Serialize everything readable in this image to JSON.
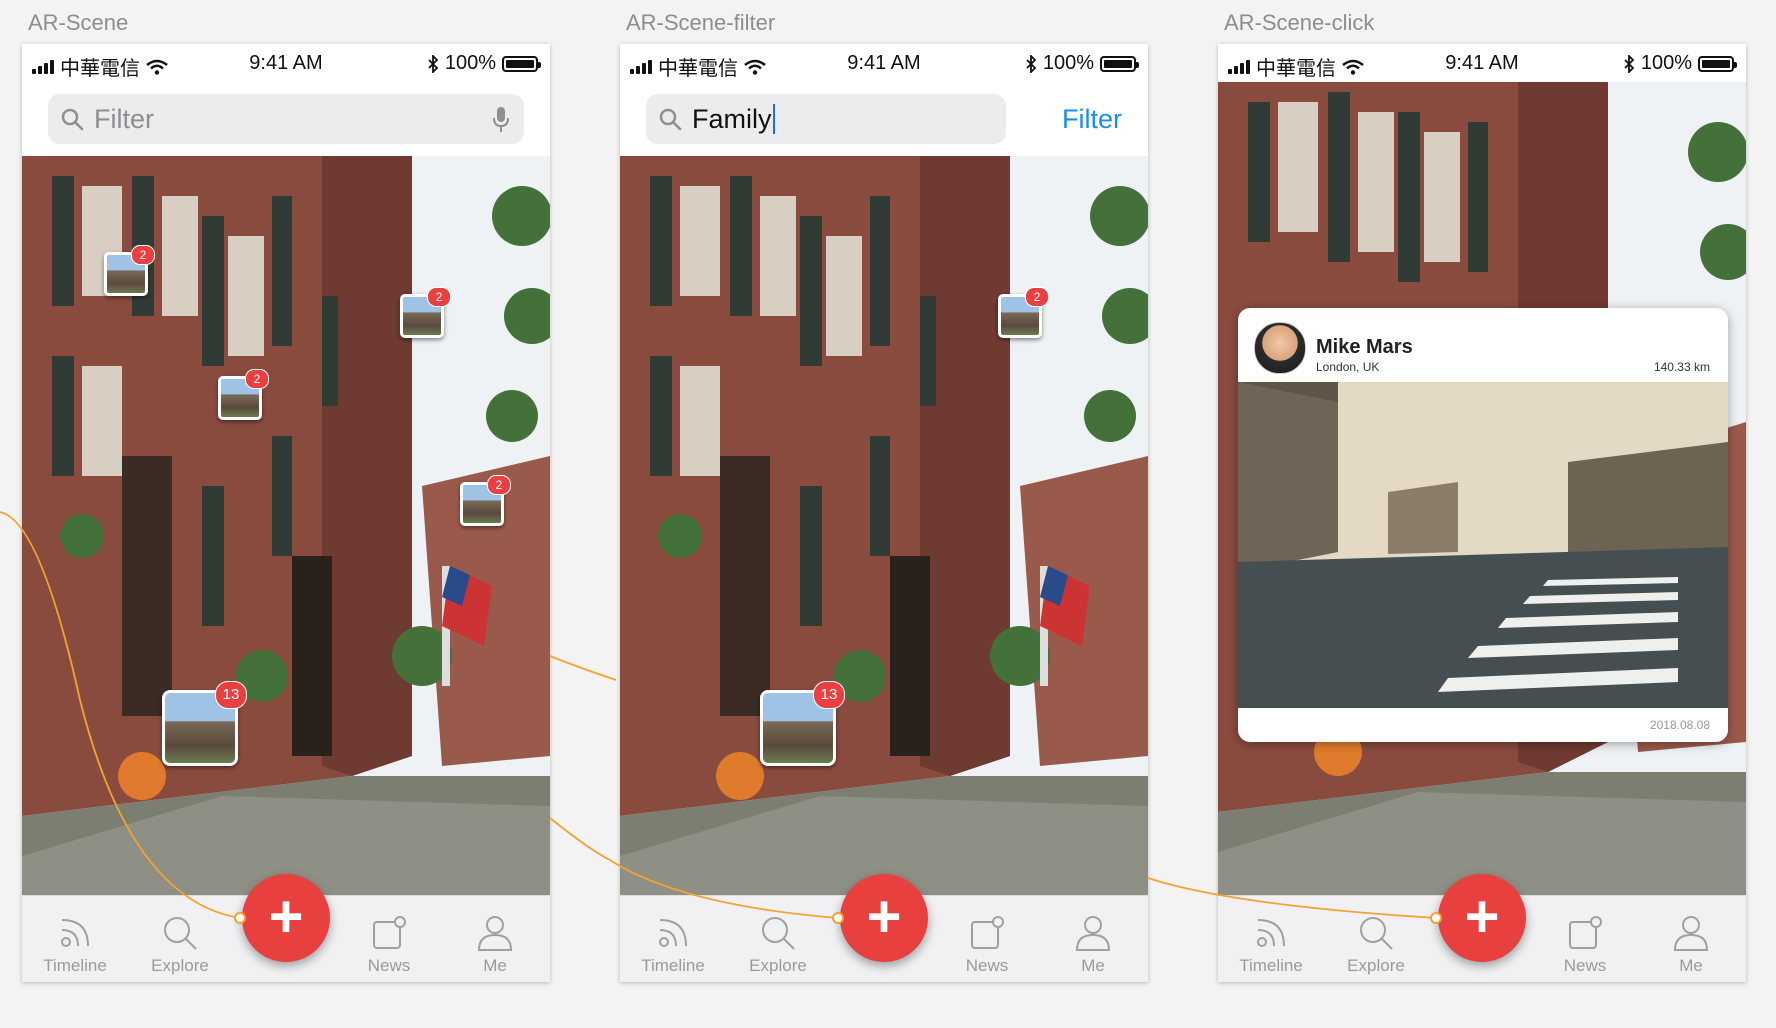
{
  "screens": [
    {
      "id": "ar-scene",
      "title": "AR-Scene",
      "status": {
        "carrier": "中華電信",
        "time": "9:41 AM",
        "battery": "100%"
      },
      "search": {
        "value": "",
        "placeholder": "Filter",
        "icon": "search-icon",
        "mic_icon": "microphone-icon"
      },
      "pins": [
        {
          "badge": "2"
        },
        {
          "badge": "2"
        },
        {
          "badge": "2"
        },
        {
          "badge": "2"
        },
        {
          "badge": "13"
        }
      ]
    },
    {
      "id": "ar-scene-filter",
      "title": "AR-Scene-filter",
      "status": {
        "carrier": "中華電信",
        "time": "9:41 AM",
        "battery": "100%"
      },
      "search": {
        "value": "Family",
        "placeholder": "",
        "icon": "search-icon"
      },
      "filter_button": "Filter",
      "pins": [
        {
          "badge": "2"
        },
        {
          "badge": "13"
        }
      ]
    },
    {
      "id": "ar-scene-click",
      "title": "AR-Scene-click",
      "status": {
        "carrier": "中華電信",
        "time": "9:41 AM",
        "battery": "100%"
      },
      "card": {
        "name": "Mike Mars",
        "location": "London, UK",
        "distance": "140.33 km",
        "date": "2018.08.08"
      }
    }
  ],
  "tabbar": {
    "items": [
      {
        "label": "Timeline",
        "icon": "rss-icon"
      },
      {
        "label": "Explore",
        "icon": "search-icon"
      },
      {
        "label": "News",
        "icon": "news-icon"
      },
      {
        "label": "Me",
        "icon": "person-icon"
      }
    ],
    "fab_label": "+",
    "fab_icon": "plus-icon"
  },
  "colors": {
    "accent_red": "#e8403f",
    "link_blue": "#1b8ef0",
    "connector": "#f2a331"
  }
}
